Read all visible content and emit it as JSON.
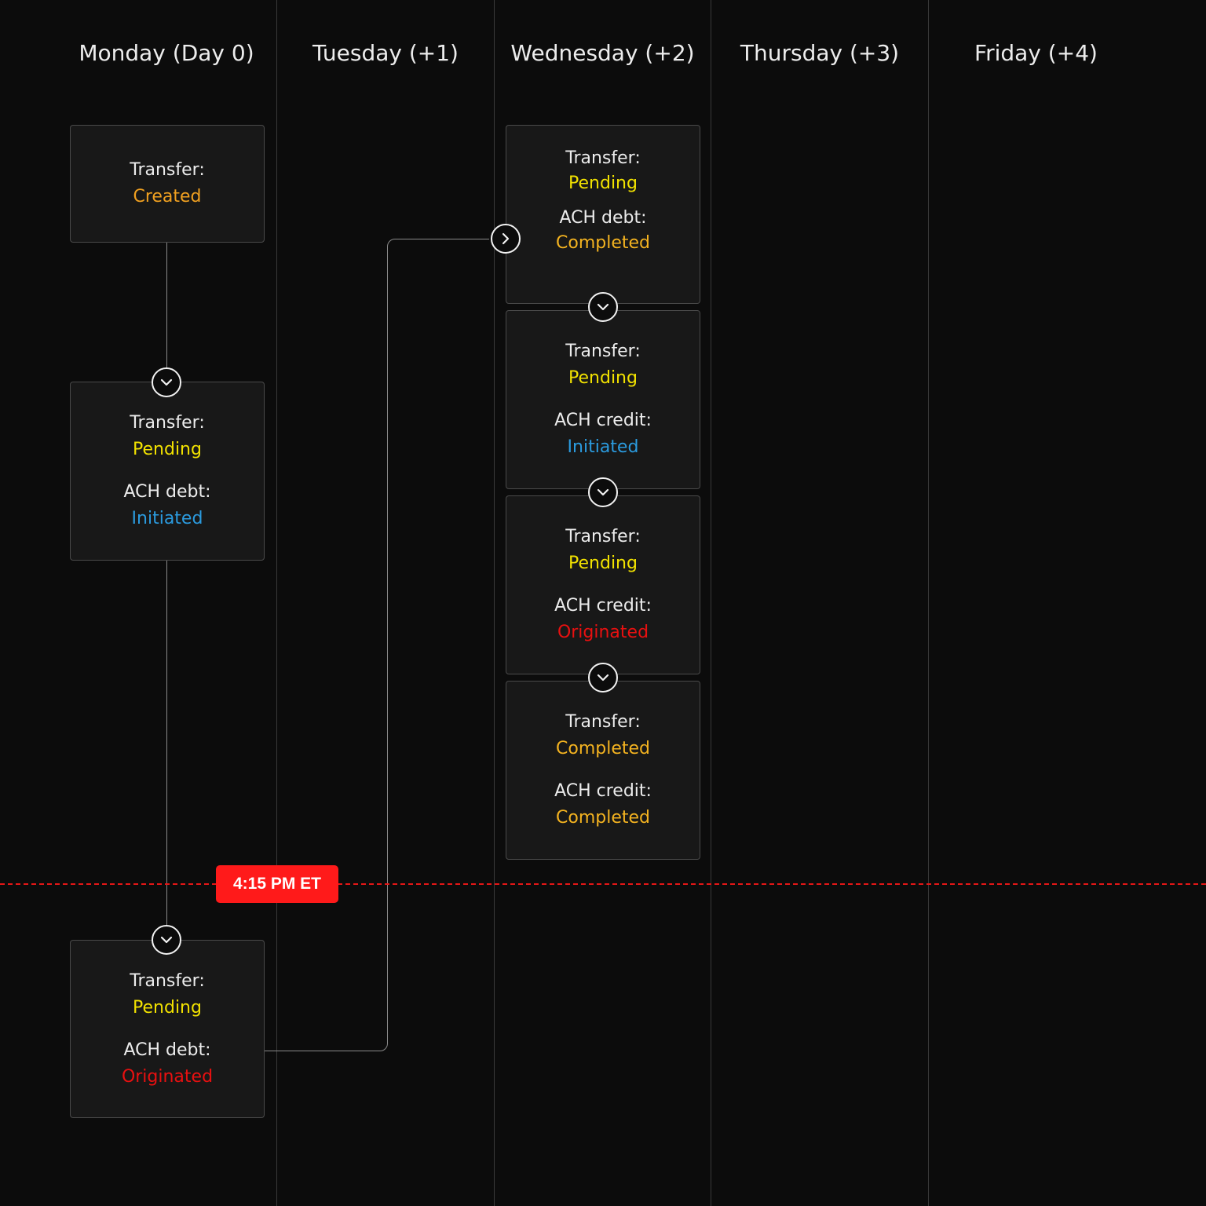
{
  "days": [
    "Monday (Day 0)",
    "Tuesday (+1)",
    "Wednesday (+2)",
    "Thursday (+3)",
    "Friday (+4)"
  ],
  "cutoff": {
    "label": "4:15 PM ET",
    "color": "#ff1a1a"
  },
  "status_colors": {
    "created": "#f0a020",
    "pending": "#f2e200",
    "initiated": "#2b9bdf",
    "originated": "#e81010",
    "completed": "#f4b320"
  },
  "cards": [
    {
      "rows": [
        {
          "label": "Transfer:",
          "value": "Created"
        }
      ]
    },
    {
      "rows": [
        {
          "label": "Transfer:",
          "value": "Pending"
        },
        {
          "label": "ACH debt:",
          "value": "Initiated"
        }
      ]
    },
    {
      "rows": [
        {
          "label": "Transfer:",
          "value": "Pending"
        },
        {
          "label": "ACH debt:",
          "value": "Originated"
        }
      ]
    },
    {
      "rows": [
        {
          "label": "Transfer:",
          "value": "Pending"
        },
        {
          "label": "ACH debt:",
          "value": "Completed"
        }
      ]
    },
    {
      "rows": [
        {
          "label": "Transfer:",
          "value": "Pending"
        },
        {
          "label": "ACH credit:",
          "value": "Initiated"
        }
      ]
    },
    {
      "rows": [
        {
          "label": "Transfer:",
          "value": "Pending"
        },
        {
          "label": "ACH credit:",
          "value": "Originated"
        }
      ]
    },
    {
      "rows": [
        {
          "label": "Transfer:",
          "value": "Completed"
        },
        {
          "label": "ACH credit:",
          "value": "Completed"
        }
      ]
    }
  ],
  "icons": {
    "step_down": "chevron-down-icon",
    "step_right": "chevron-right-icon"
  }
}
